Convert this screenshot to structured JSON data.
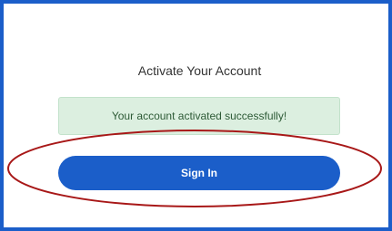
{
  "page": {
    "title": "Activate Your Account"
  },
  "alert": {
    "message": "Your account activated successfully!"
  },
  "actions": {
    "signin_label": "Sign In"
  },
  "colors": {
    "primary": "#1b5ec9",
    "alert_background": "#dcefe0",
    "alert_text": "#2d5a36",
    "annotation": "#a81818"
  }
}
